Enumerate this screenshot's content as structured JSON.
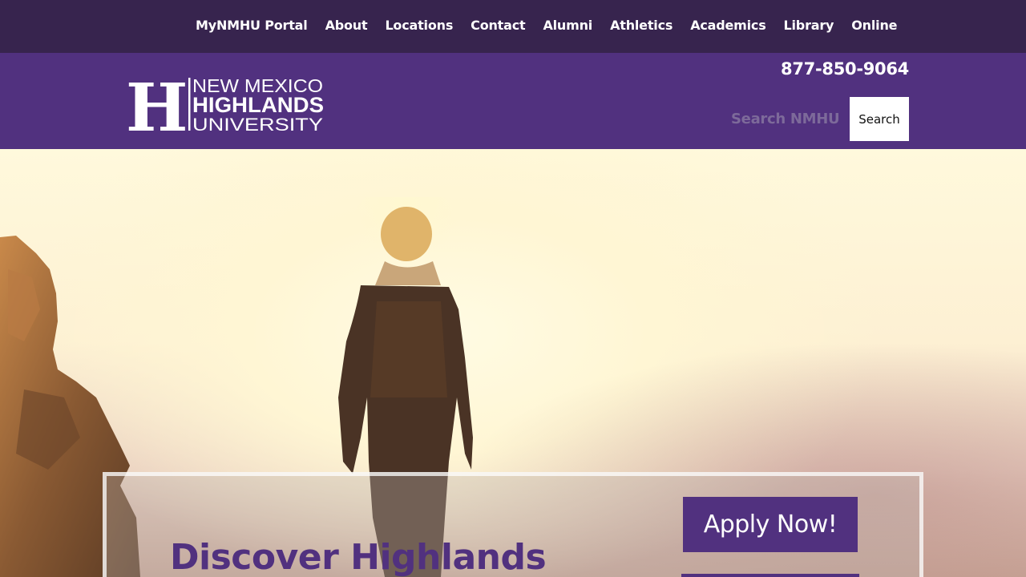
{
  "topnav": {
    "items": [
      {
        "label": "MyNMHU Portal"
      },
      {
        "label": "About"
      },
      {
        "label": "Locations"
      },
      {
        "label": "Contact"
      },
      {
        "label": "Alumni"
      },
      {
        "label": "Athletics"
      },
      {
        "label": "Academics"
      },
      {
        "label": "Library"
      },
      {
        "label": "Online"
      }
    ]
  },
  "header": {
    "logo": {
      "line1": "NEW MEXICO",
      "line2": "HIGHLANDS",
      "line3": "UNIVERSITY",
      "mark": "H"
    },
    "phone": "877-850-9064",
    "search": {
      "placeholder": "Search NMHU",
      "button_label": "Search"
    }
  },
  "hero": {
    "title": "Discover Highlands",
    "apply_label": "Apply Now!"
  },
  "colors": {
    "nav_bg": "#37244e",
    "header_bg": "#51317f",
    "accent": "#51317f",
    "text_light": "#ffffff"
  }
}
